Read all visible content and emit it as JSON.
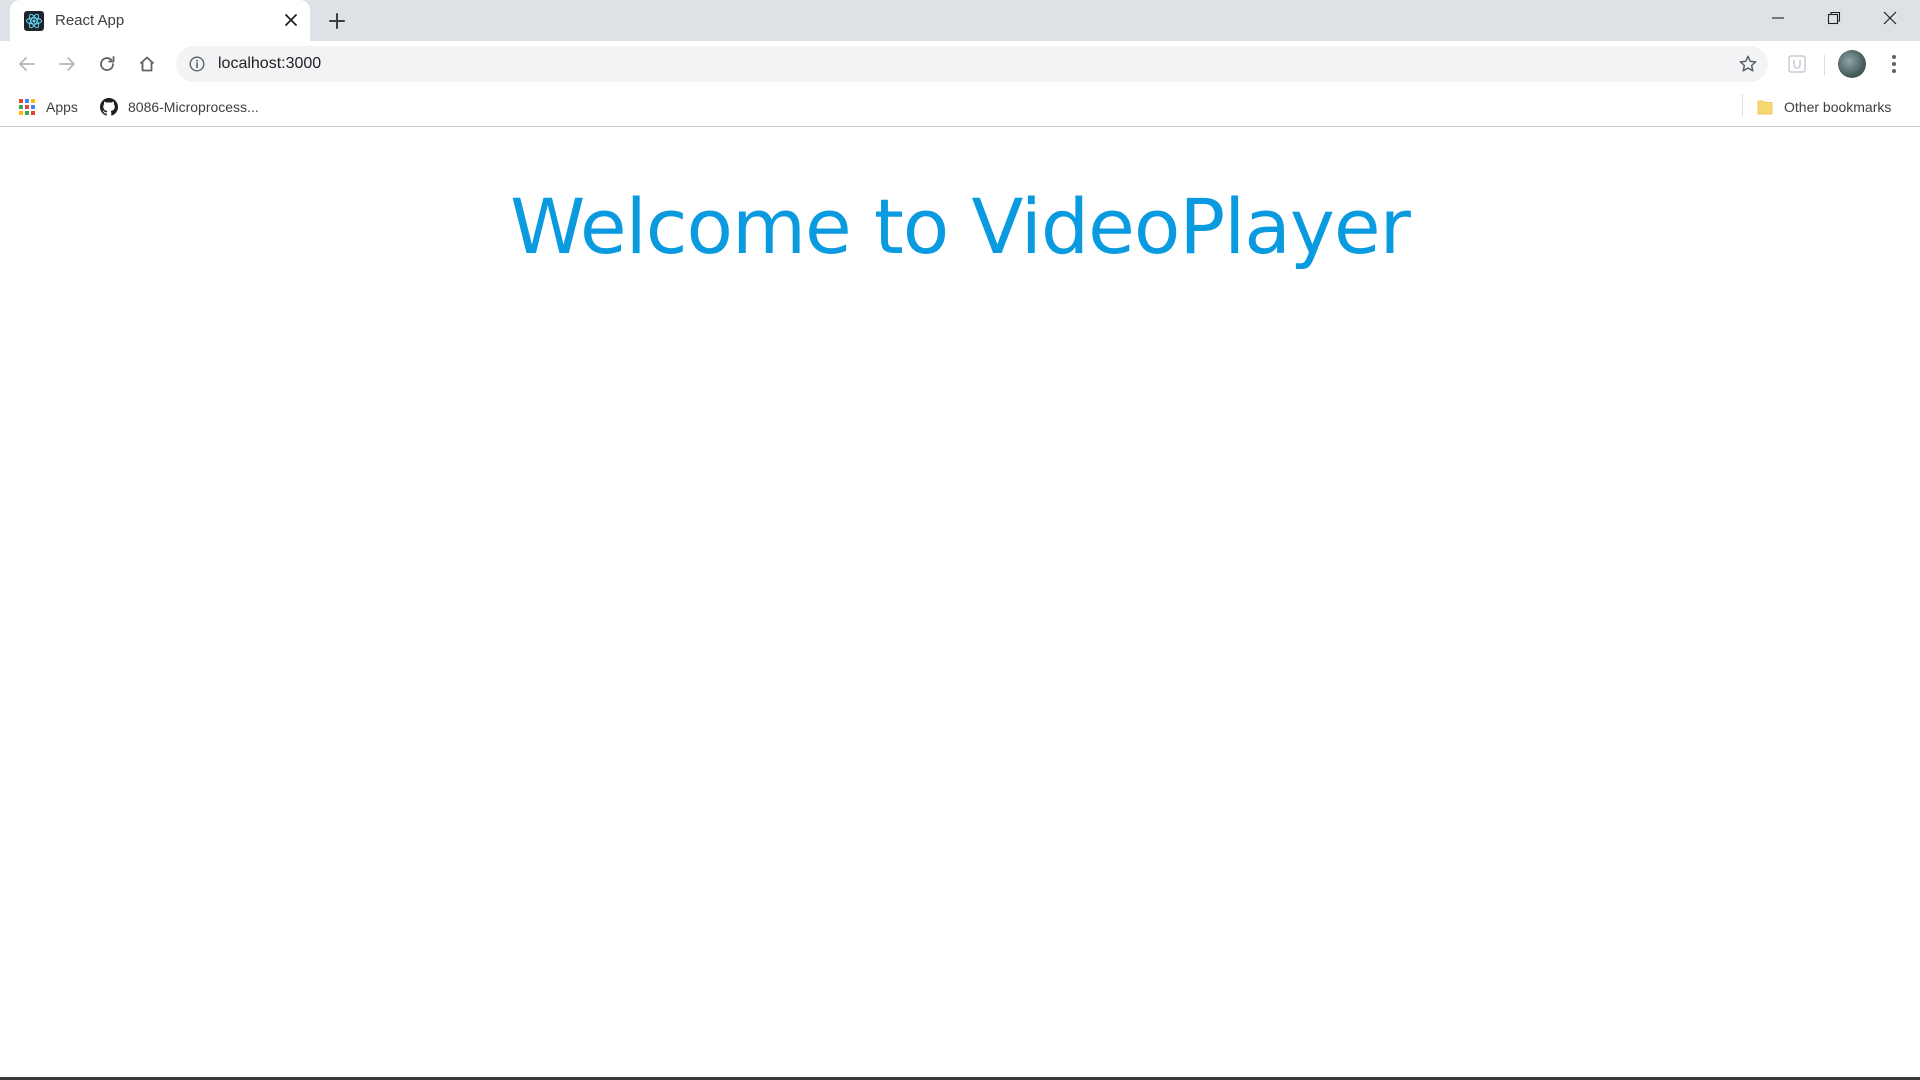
{
  "browser": {
    "tab": {
      "title": "React App",
      "favicon": "react-logo-icon"
    },
    "address": {
      "url": "localhost:3000"
    },
    "bookmarks": [
      {
        "label": "Apps",
        "icon": "apps-grid-icon"
      },
      {
        "label": "8086-Microprocess...",
        "icon": "github-icon"
      }
    ],
    "other_bookmarks": {
      "label": "Other bookmarks",
      "icon": "folder-icon"
    }
  },
  "page": {
    "heading": "Welcome to VideoPlayer"
  },
  "colors": {
    "heading": "#0a9ae0",
    "tabstrip": "#dee1e6",
    "omnibox": "#f1f3f4",
    "react_logo": "#61dafb"
  }
}
